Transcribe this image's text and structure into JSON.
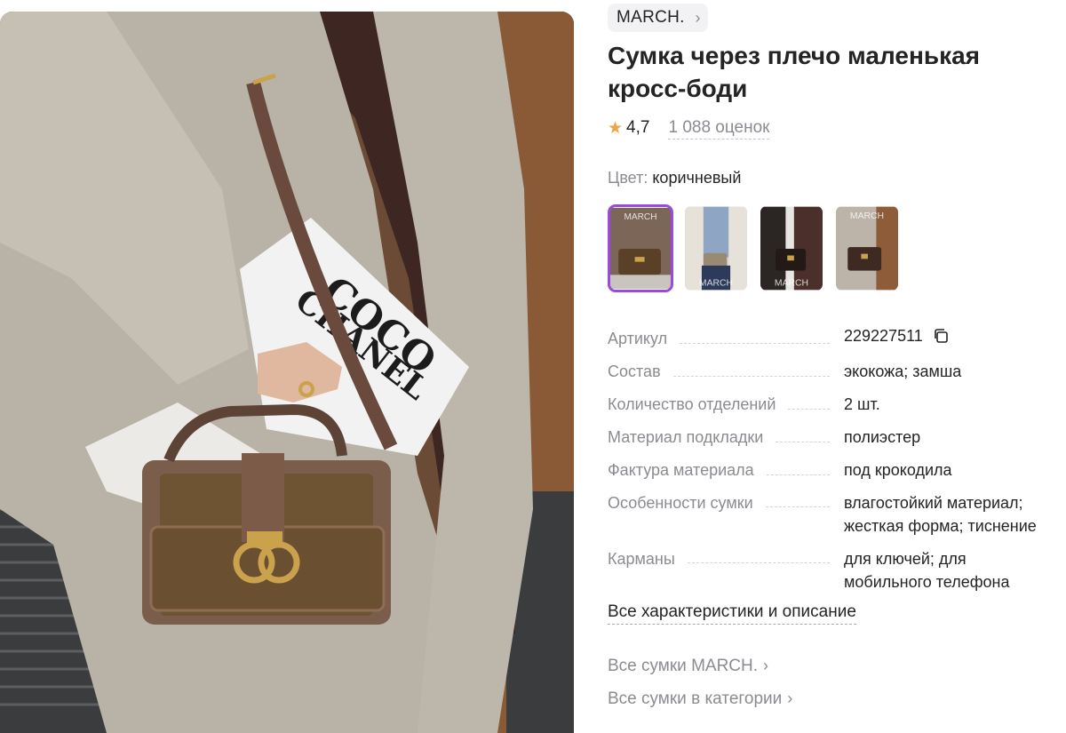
{
  "brand": {
    "label": "MARCH.",
    "chevron_icon": "chevron-right-icon"
  },
  "product": {
    "title": "Сумка через плечо маленькая кросс-боди",
    "rating": "4,7",
    "reviews": "1 088 оценок"
  },
  "color": {
    "label": "Цвет:",
    "value": "коричневый"
  },
  "photo_text": {
    "magazine_title": "COCO",
    "magazine_subtitle": "CHANEL"
  },
  "swatches": [
    {
      "name": "swatch-1",
      "watermark": "MARCH",
      "active": true
    },
    {
      "name": "swatch-2",
      "watermark": "MARCH",
      "active": false
    },
    {
      "name": "swatch-3",
      "watermark": "MARCH",
      "active": false
    },
    {
      "name": "swatch-4",
      "watermark": "MARCH",
      "active": false
    }
  ],
  "specs": [
    {
      "key": "Артикул",
      "value": "229227511"
    },
    {
      "key": "Состав",
      "value": "экокожа; замша"
    },
    {
      "key": "Количество отделений",
      "value": "2 шт."
    },
    {
      "key": "Материал подкладки",
      "value": "полиэстер"
    },
    {
      "key": "Фактура материала",
      "value": "под крокодила"
    },
    {
      "key": "Особенности сумки",
      "value": "влагостойкий материал; жесткая форма; тиснение"
    },
    {
      "key": "Карманы",
      "value": "для ключей; для мобильного телефона"
    }
  ],
  "links": {
    "all_characteristics": "Все характеристики и описание",
    "brand_bags": "Все сумки MARCH.",
    "category_bags": "Все сумки в категории"
  },
  "colors": {
    "accent": "#9b4bdb",
    "star": "#f2a341",
    "muted": "#8b8b92",
    "text": "#242424"
  }
}
